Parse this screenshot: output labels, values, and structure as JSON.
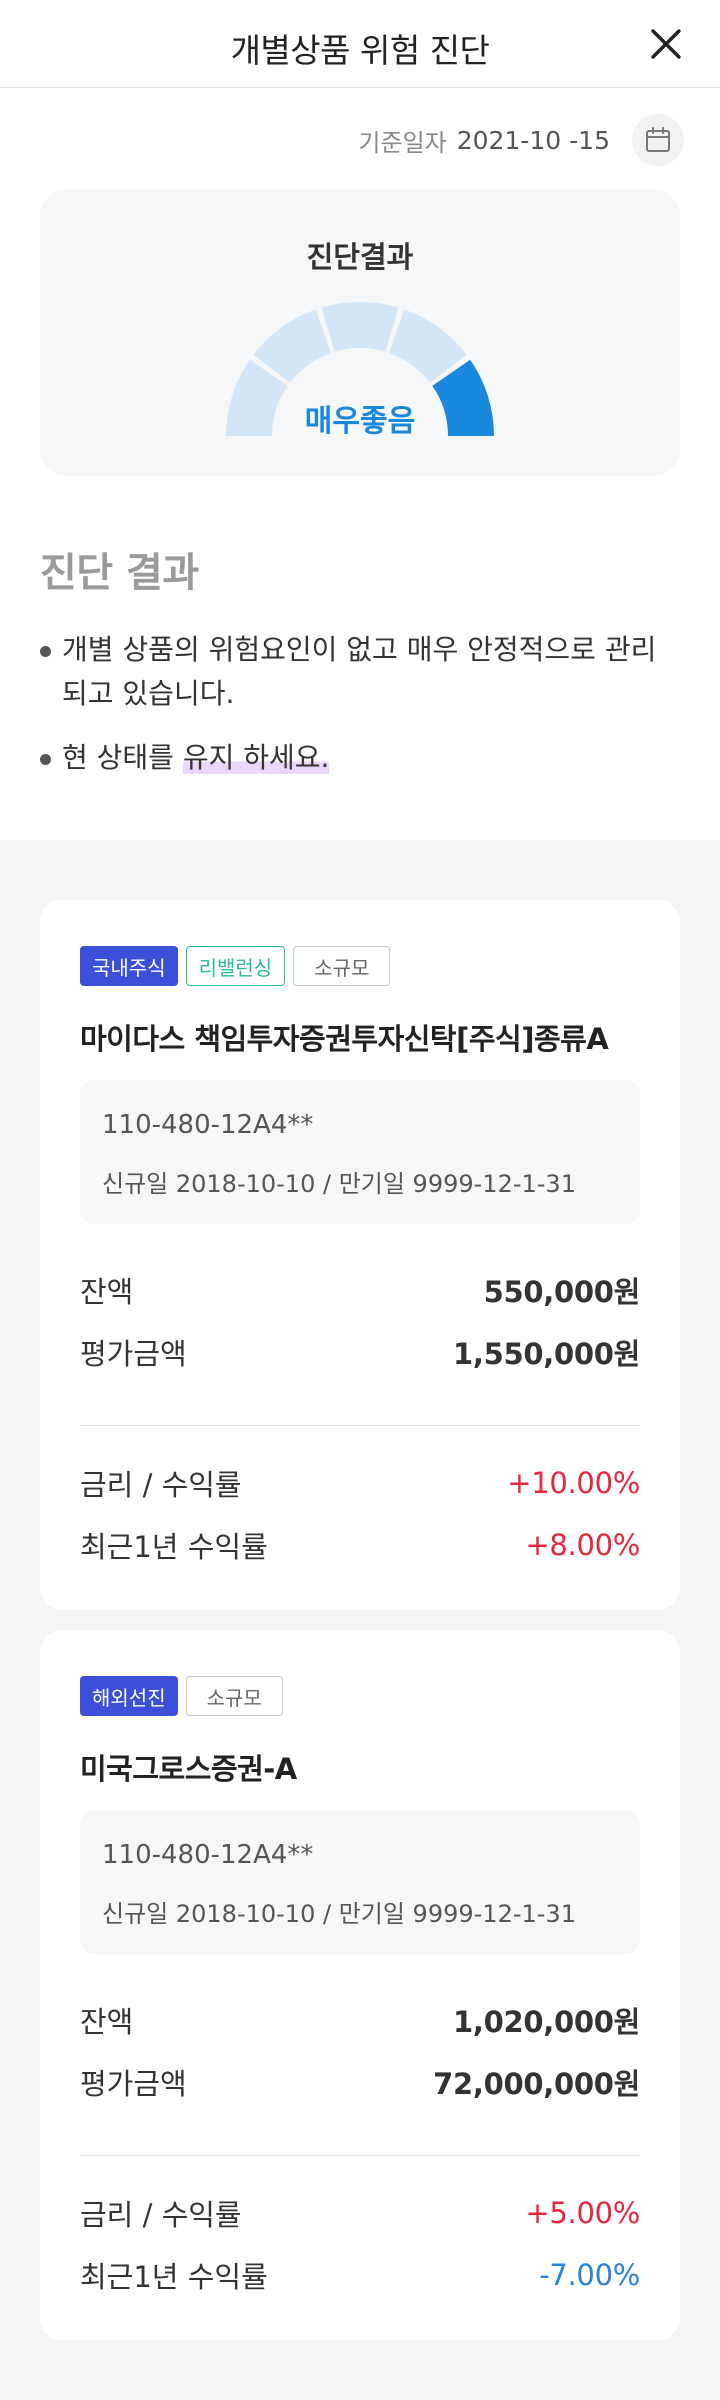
{
  "header": {
    "title": "개별상품 위험 진단"
  },
  "date": {
    "label": "기준일자",
    "value": "2021-10 -15"
  },
  "result": {
    "title": "진단결과",
    "status": "매우좋음"
  },
  "diagnosis": {
    "heading": "진단 결과",
    "bullets": [
      "개별 상품의 위험요인이 없고 매우 안정적으로 관리되고 있습니다.",
      "현 상태를 "
    ],
    "highlight": "유지 하세요."
  },
  "cards": [
    {
      "tags": [
        "국내주식",
        "리밸런싱",
        "소규모"
      ],
      "name": "마이다스 책임투자증권투자신탁[주식]종류A",
      "account": "110-480-12A4**",
      "dates": "신규일 2018-10-10  /  만기일 9999-12-1-31",
      "balance_label": "잔액",
      "balance": "550,000원",
      "eval_label": "평가금액",
      "eval": "1,550,000원",
      "rate_label": "금리 / 수익률",
      "rate": "+10.00%",
      "year_label": "최근1년 수익률",
      "year": "+8.00%"
    },
    {
      "tags": [
        "해외선진",
        "소규모"
      ],
      "name": "미국그로스증권-A",
      "account": "110-480-12A4**",
      "dates": "신규일 2018-10-10  /  만기일 9999-12-1-31",
      "balance_label": "잔액",
      "balance": "1,020,000원",
      "eval_label": "평가금액",
      "eval": "72,000,000원",
      "rate_label": "금리 / 수익률",
      "rate": "+5.00%",
      "year_label": "최근1년 수익률",
      "year": "-7.00%"
    }
  ],
  "colors": {
    "accent": "#1a88dc",
    "tag_blue": "#3c4fd8",
    "tag_green": "#2bb99a",
    "positive": "#e5283f",
    "negative": "#2a84dd"
  },
  "gauge": {
    "segments": 5,
    "active_segment": 5
  }
}
